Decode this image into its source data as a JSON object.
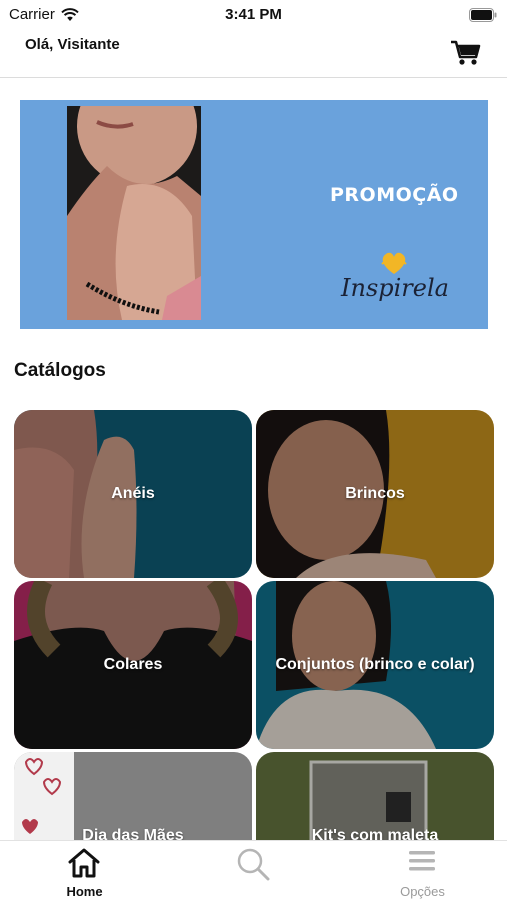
{
  "status_bar": {
    "carrier": "Carrier",
    "time": "3:41 PM"
  },
  "header": {
    "greeting": "Olá, Visitante"
  },
  "banner": {
    "promo_text": "PROMOÇÃO",
    "brand": "Inspirela"
  },
  "catalogs": {
    "title": "Catálogos",
    "items": [
      {
        "label": "Anéis"
      },
      {
        "label": "Brincos"
      },
      {
        "label": "Colares"
      },
      {
        "label": "Conjuntos (brinco e colar)"
      },
      {
        "label": "Dia das Mães"
      },
      {
        "label": "Kit's com maleta"
      }
    ]
  },
  "tabbar": {
    "tabs": [
      {
        "label": "Home",
        "icon": "home-icon",
        "active": true
      },
      {
        "label": "",
        "icon": "search-icon",
        "active": false
      },
      {
        "label": "Opções",
        "icon": "menu-icon",
        "active": false
      }
    ]
  },
  "colors": {
    "banner_bg": "#6aa2dc",
    "tab_active": "#111111",
    "tab_inactive": "#9a9a9a"
  }
}
